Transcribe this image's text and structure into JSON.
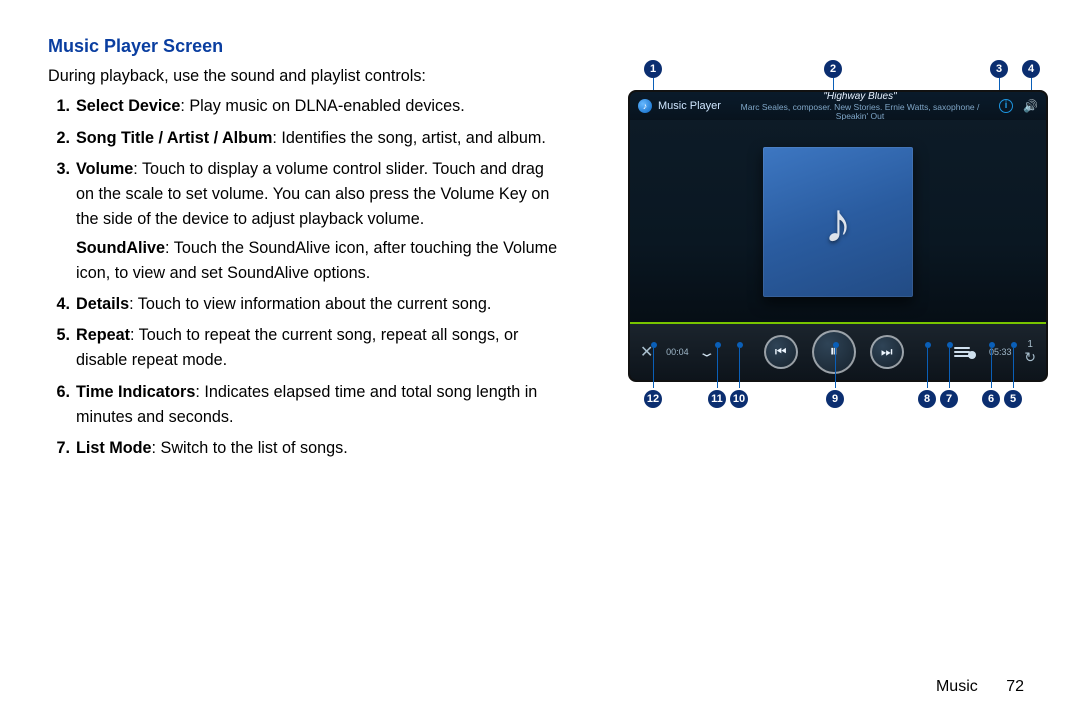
{
  "heading": "Music Player Screen",
  "intro": "During playback, use the sound and playlist controls:",
  "list": [
    {
      "num": "1.",
      "term": "Select Device",
      "text": ": Play music on DLNA-enabled devices."
    },
    {
      "num": "2.",
      "term": "Song Title / Artist / Album",
      "text": ": Identifies the song, artist, and album."
    },
    {
      "num": "3.",
      "term": "Volume",
      "text": ": Touch to display a volume control slider. Touch and drag on the scale to set volume. You can also press the Volume Key on the side of the device to adjust playback volume.",
      "sub_term": "SoundAlive",
      "sub_text": ": Touch the SoundAlive icon, after touching the Volume icon, to view and set SoundAlive options."
    },
    {
      "num": "4.",
      "term": "Details",
      "text": ": Touch to view information about the current song."
    },
    {
      "num": "5.",
      "term": "Repeat",
      "text": ": Touch to repeat the current song, repeat all songs, or disable repeat mode."
    },
    {
      "num": "6.",
      "term": "Time Indicators",
      "text": ": Indicates elapsed time and total song length in minutes and seconds."
    },
    {
      "num": "7.",
      "term": "List Mode",
      "text": ": Switch to the list of songs."
    }
  ],
  "footer": {
    "section": "Music",
    "page": "72"
  },
  "callouts_top": {
    "a": "1",
    "b": "2",
    "c": "3",
    "d": "4"
  },
  "callouts_bottom": {
    "n5": "5",
    "n6": "6",
    "n7": "7",
    "n8": "8",
    "n9": "9",
    "n10": "10",
    "n11": "11",
    "n12": "12"
  },
  "player": {
    "app_title": "Music Player",
    "song": "\"Highway Blues\"",
    "artist": "Marc Seales, composer. New Stories. Ernie Watts, saxophone / Speakin' Out",
    "info_glyph": "i",
    "volume_glyph": "🔊",
    "note_glyph": "♪",
    "elapsed": "00:04",
    "total": "05:33",
    "prev_glyph": "⏮",
    "pause_glyph": "⏸",
    "next_glyph": "⏭",
    "shuffle_glyph": "✕",
    "chevron_glyph": "⌄",
    "repeat_num": "1",
    "repeat_arc": "↻",
    "back_glyph": "‹"
  }
}
